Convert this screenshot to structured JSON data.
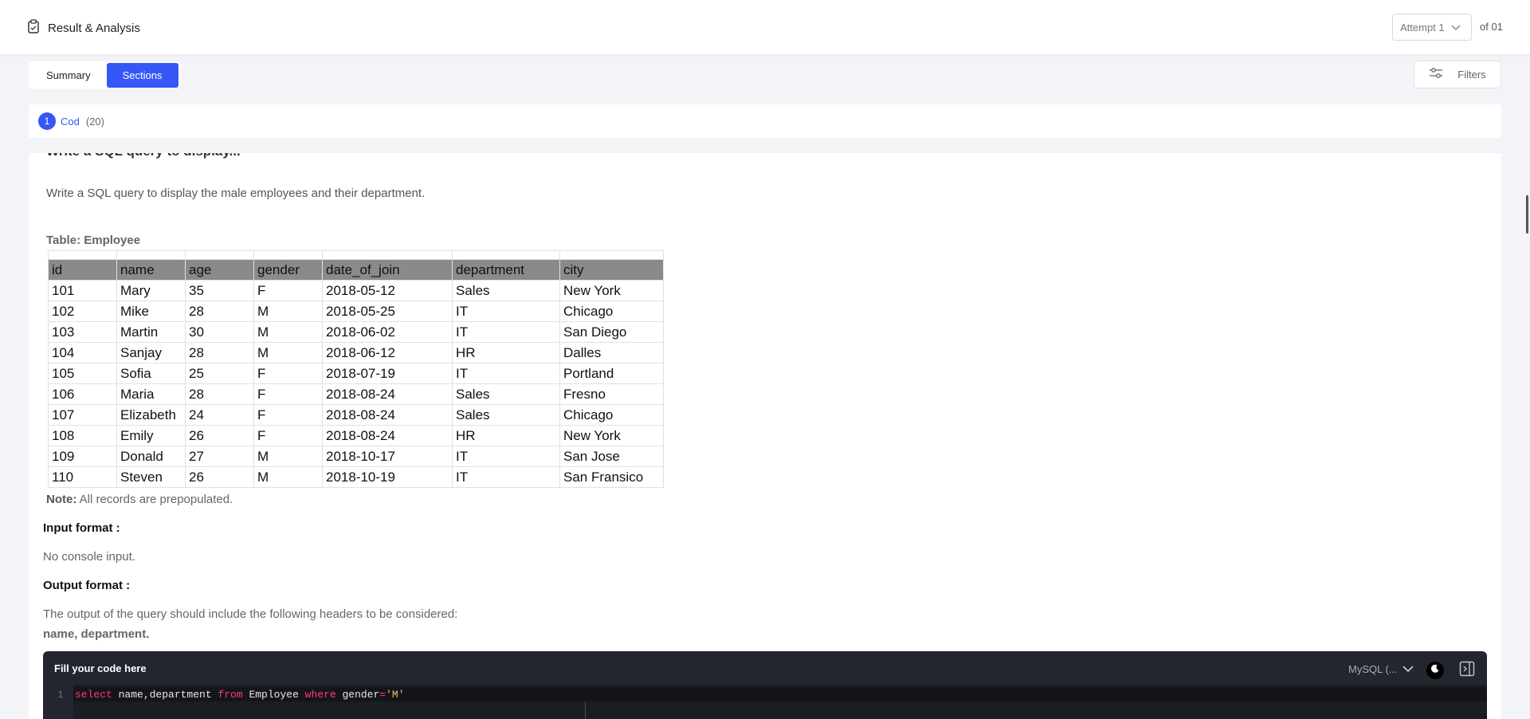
{
  "header": {
    "title": "Result & Analysis",
    "attempt_label": "Attempt 1",
    "of_label": "of 01"
  },
  "tabs": [
    {
      "label": "Summary",
      "active": false
    },
    {
      "label": "Sections",
      "active": true
    }
  ],
  "filters_label": "Filters",
  "section": {
    "number": "1",
    "name": "Cod",
    "count": "(20)"
  },
  "question": {
    "cut_heading": "Write a SQL query to display...",
    "text": "Write a SQL query to  display the male employees and their department.",
    "table_title": "Table: Employee",
    "columns": [
      "id",
      "name",
      "age",
      "gender",
      "date_of_join",
      "department",
      "city"
    ],
    "rows": [
      [
        "101",
        "Mary",
        "35",
        "F",
        "2018-05-12",
        "Sales",
        "New York"
      ],
      [
        "102",
        "Mike",
        "28",
        "M",
        "2018-05-25",
        "IT",
        "Chicago"
      ],
      [
        "103",
        "Martin",
        "30",
        "M",
        "2018-06-02",
        "IT",
        "San Diego"
      ],
      [
        "104",
        "Sanjay",
        "28",
        "M",
        "2018-06-12",
        "HR",
        "Dalles"
      ],
      [
        "105",
        "Sofia",
        "25",
        "F",
        "2018-07-19",
        "IT",
        "Portland"
      ],
      [
        "106",
        "Maria",
        "28",
        "F",
        "2018-08-24",
        "Sales",
        "Fresno"
      ],
      [
        "107",
        "Elizabeth",
        "24",
        "F",
        "2018-08-24",
        "Sales",
        "Chicago"
      ],
      [
        "108",
        "Emily",
        "26",
        "F",
        "2018-08-24",
        "HR",
        "New York"
      ],
      [
        "109",
        "Donald",
        "27",
        "M",
        "2018-10-17",
        "IT",
        "San Jose"
      ],
      [
        "110",
        "Steven",
        "26",
        "M",
        "2018-10-19",
        "IT",
        "San Fransico"
      ]
    ],
    "note_label": "Note:",
    "note_text": " All records are prepopulated.",
    "input_format_heading": "Input format :",
    "input_format_text": "No console input.",
    "output_format_heading": "Output format :",
    "output_format_text": "The output of the query should include the following headers to be considered:",
    "output_headers": "name, department."
  },
  "editor": {
    "title": "Fill your code here",
    "language": "MySQL (...",
    "line_number": "1",
    "code": {
      "kw_select": "select",
      "cols": " name,department ",
      "kw_from": "from",
      "table": " Employee ",
      "kw_where": "where",
      "cond": " gender",
      "eq": "=",
      "value": "'M'"
    }
  },
  "colors": {
    "accent": "#3557f5",
    "editor_bg": "#23262f",
    "keyword": "#ff3b6f",
    "string": "#e6c36a"
  }
}
